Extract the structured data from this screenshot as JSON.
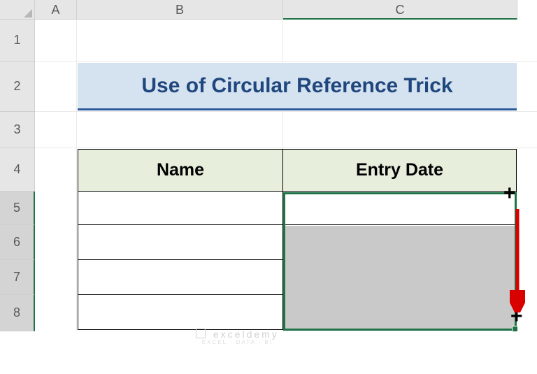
{
  "columns": {
    "A": "A",
    "B": "B",
    "C": "C"
  },
  "rows": {
    "r1": "1",
    "r2": "2",
    "r3": "3",
    "r4": "4",
    "r5": "5",
    "r6": "6",
    "r7": "7",
    "r8": "8"
  },
  "title": "Use of Circular Reference Trick",
  "table": {
    "headers": {
      "name": "Name",
      "entry_date": "Entry Date"
    },
    "data": [
      {
        "name": "",
        "entry_date": ""
      },
      {
        "name": "",
        "entry_date": ""
      },
      {
        "name": "",
        "entry_date": ""
      },
      {
        "name": "",
        "entry_date": ""
      }
    ]
  },
  "selection": {
    "range": "C5:C8",
    "active_cell": "C5"
  },
  "annotation": {
    "action": "fill-down-drag",
    "from_row": 5,
    "to_row": 8
  },
  "watermark": {
    "brand": "exceldemy",
    "tagline": "EXCEL · DATA · BI"
  },
  "chart_data": {
    "type": "table",
    "title": "Use of Circular Reference Trick",
    "columns": [
      "Name",
      "Entry Date"
    ],
    "rows": [
      [
        "",
        ""
      ],
      [
        "",
        ""
      ],
      [
        "",
        ""
      ],
      [
        "",
        ""
      ]
    ]
  }
}
